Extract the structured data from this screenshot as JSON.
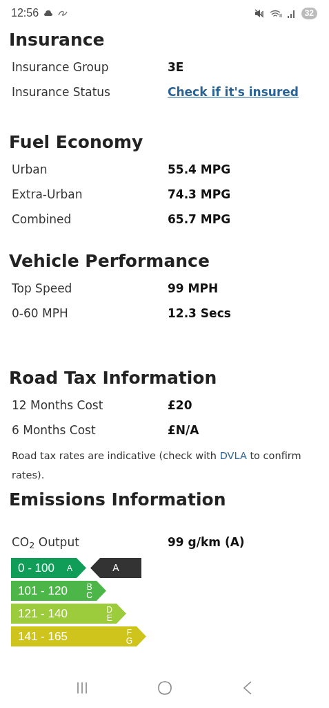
{
  "status_bar": {
    "time": "12:56",
    "battery": "32"
  },
  "sections": [
    {
      "title": "Insurance",
      "rows": [
        {
          "label": "Insurance Group",
          "value": "3E",
          "kind": "text"
        },
        {
          "label": "Insurance Status",
          "value": "Check if it's insured",
          "kind": "link"
        }
      ]
    },
    {
      "title": "Fuel Economy",
      "rows": [
        {
          "label": "Urban",
          "value": "55.4 MPG",
          "kind": "text"
        },
        {
          "label": "Extra-Urban",
          "value": "74.3 MPG",
          "kind": "text"
        },
        {
          "label": "Combined",
          "value": "65.7 MPG",
          "kind": "text"
        }
      ]
    },
    {
      "title": "Vehicle Performance",
      "rows": [
        {
          "label": "Top Speed",
          "value": "99 MPH",
          "kind": "text"
        },
        {
          "label": "0-60 MPH",
          "value": "12.3 Secs",
          "kind": "text"
        }
      ]
    },
    {
      "title": "Road Tax Information",
      "rows": [
        {
          "label": "12 Months Cost",
          "value": "£20",
          "kind": "text"
        },
        {
          "label": "6 Months Cost",
          "value": "£N/A",
          "kind": "text"
        }
      ],
      "note": {
        "before": "Road tax rates are indicative (check with ",
        "link": "DVLA",
        "after": " to confirm rates)."
      }
    },
    {
      "title": "Emissions Information",
      "rows": [
        {
          "label": "CO$_{2}$ Output",
          "value": "99 g/km (A)",
          "kind": "text"
        }
      ],
      "bands": [
        {
          "range": "0 - 100",
          "letters": [
            "A"
          ],
          "color": "#0f9d58",
          "selected": true,
          "rating": "A"
        },
        {
          "range": "101 - 120",
          "letters": [
            "B",
            "C"
          ],
          "color": "#4cb748",
          "selected": false
        },
        {
          "range": "121 - 140",
          "letters": [
            "D",
            "E"
          ],
          "color": "#9ccb3b",
          "selected": false
        },
        {
          "range": "141 - 165",
          "letters": [
            "F",
            "G"
          ],
          "color": "#cfc41c",
          "selected": false
        }
      ]
    }
  ]
}
